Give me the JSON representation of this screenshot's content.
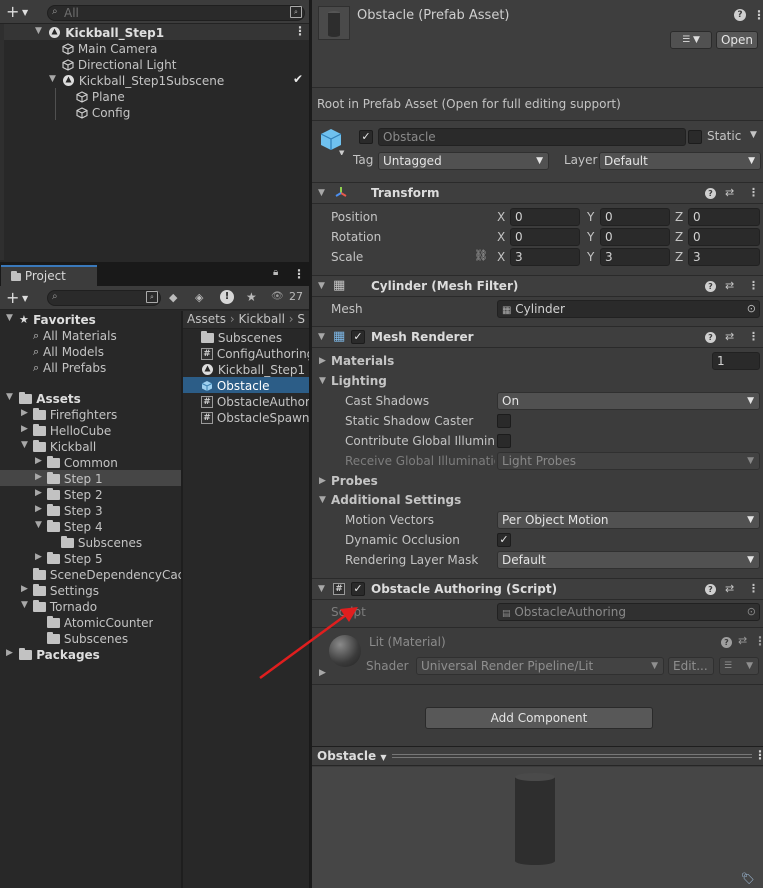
{
  "hierarchy": {
    "search_placeholder": "All",
    "items": [
      {
        "label": "Kickball_Step1"
      },
      {
        "label": "Main Camera"
      },
      {
        "label": "Directional Light"
      },
      {
        "label": "Kickball_Step1Subscene"
      },
      {
        "label": "Plane"
      },
      {
        "label": "Config"
      }
    ]
  },
  "project": {
    "tab_label": "Project",
    "hidden_count": "27",
    "favorites": {
      "label": "Favorites",
      "items": [
        "All Materials",
        "All Models",
        "All Prefabs"
      ]
    },
    "assets_label": "Assets",
    "tree": [
      "Firefighters",
      "HelloCube",
      "Kickball",
      "Common",
      "Step 1",
      "Step 2",
      "Step 3",
      "Step 4",
      "Subscenes",
      "Step 5",
      "SceneDependencyCache",
      "Settings",
      "Tornado",
      "AtomicCounter",
      "Subscenes"
    ],
    "packages_label": "Packages",
    "breadcrumb": [
      "Assets",
      "Kickball",
      "S"
    ],
    "files": [
      "Subscenes",
      "ConfigAuthoring",
      "Kickball_Step1",
      "Obstacle",
      "ObstacleAuthoring",
      "ObstacleSpawner"
    ]
  },
  "inspector": {
    "title": "Obstacle (Prefab Asset)",
    "open_label": "Open",
    "root_note": "Root in Prefab Asset (Open for full editing support)",
    "object_name": "Obstacle",
    "static_label": "Static",
    "tag_label": "Tag",
    "tag_value": "Untagged",
    "layer_label": "Layer",
    "layer_value": "Default",
    "transform": {
      "title": "Transform",
      "position_label": "Position",
      "rotation_label": "Rotation",
      "scale_label": "Scale",
      "position": [
        "0",
        "0",
        "0"
      ],
      "rotation": [
        "0",
        "0",
        "0"
      ],
      "scale": [
        "3",
        "3",
        "3"
      ],
      "axes": [
        "X",
        "Y",
        "Z"
      ]
    },
    "mesh_filter": {
      "title": "Cylinder (Mesh Filter)",
      "mesh_label": "Mesh",
      "mesh_value": "Cylinder"
    },
    "mesh_renderer": {
      "title": "Mesh Renderer",
      "materials_label": "Materials",
      "materials_count": "1",
      "lighting_label": "Lighting",
      "cast_shadows_label": "Cast Shadows",
      "cast_shadows_value": "On",
      "static_shadow_label": "Static Shadow Caster",
      "contribute_gi_label": "Contribute Global Illumination",
      "receive_gi_label": "Receive Global Illumination",
      "receive_gi_value": "Light Probes",
      "probes_label": "Probes",
      "additional_label": "Additional Settings",
      "motion_vectors_label": "Motion Vectors",
      "motion_vectors_value": "Per Object Motion",
      "dynamic_occlusion_label": "Dynamic Occlusion",
      "rendering_layer_label": "Rendering Layer Mask",
      "rendering_layer_value": "Default"
    },
    "authoring": {
      "title": "Obstacle Authoring (Script)",
      "script_label": "Script",
      "script_value": "ObstacleAuthoring"
    },
    "material": {
      "title": "Lit (Material)",
      "shader_label": "Shader",
      "shader_value": "Universal Render Pipeline/Lit",
      "edit_label": "Edit..."
    },
    "add_component_label": "Add Component",
    "preview_label": "Obstacle"
  }
}
